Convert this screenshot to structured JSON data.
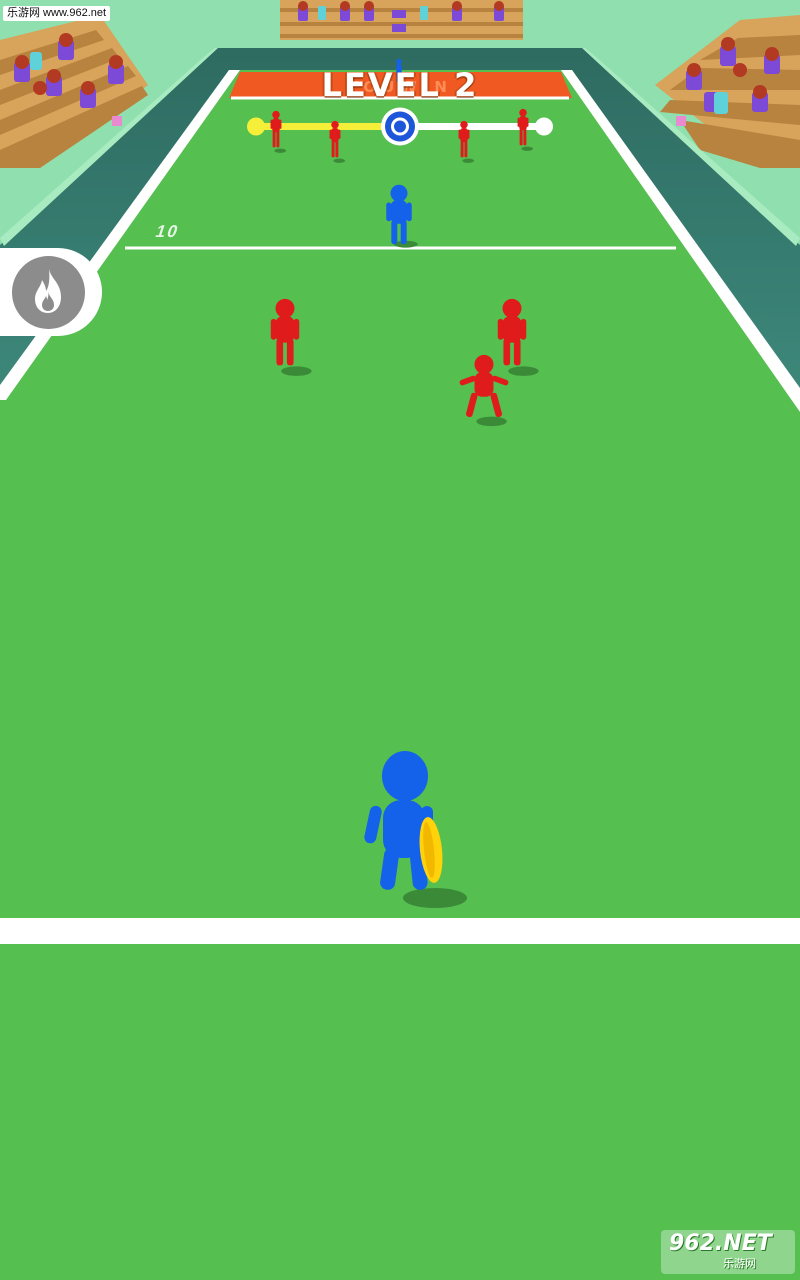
{
  "watermark_top": "乐游网 www.962.net",
  "hud": {
    "level_title": "LEVEL 2",
    "progress": 0.5,
    "progress_fill_color": "#f6ef3a",
    "progress_marker_color": "#1e56d9"
  },
  "field": {
    "yard_number": "10",
    "grass_color": "#55bf50",
    "endzone_color": "#f05a22",
    "endzone_text": "YOUWIN"
  },
  "team_colors": {
    "player": "#1461ea",
    "opponent": "#e01b1b",
    "ball": "#ffd20a"
  },
  "powerup": {
    "icon": "fire-icon"
  },
  "logo": {
    "main": "962.NET",
    "sub": "乐游网"
  }
}
